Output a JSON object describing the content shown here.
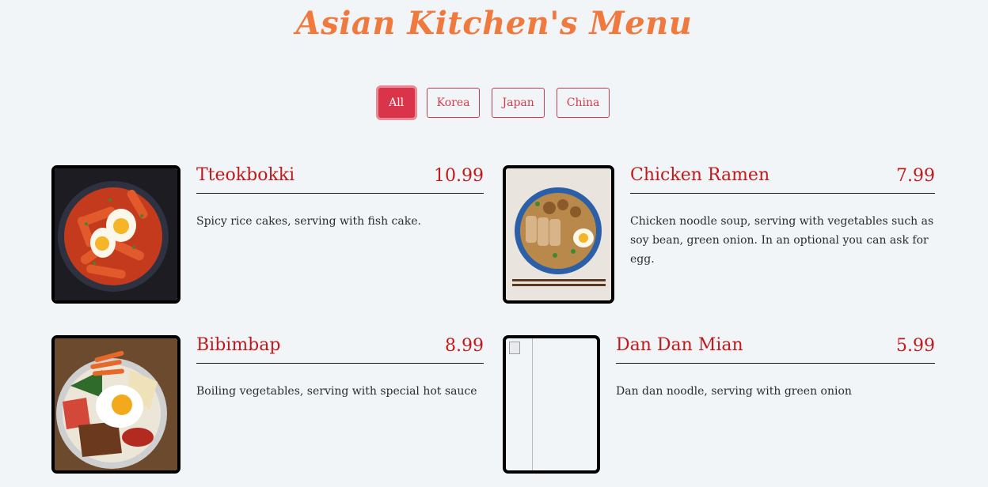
{
  "header": {
    "title": "Asian Kitchen's Menu"
  },
  "filters": [
    {
      "label": "All",
      "active": true
    },
    {
      "label": "Korea",
      "active": false
    },
    {
      "label": "Japan",
      "active": false
    },
    {
      "label": "China",
      "active": false
    }
  ],
  "items": [
    {
      "name": "Tteokbokki",
      "price": "10.99",
      "desc": "Spicy rice cakes, serving with fish cake."
    },
    {
      "name": "Chicken Ramen",
      "price": "7.99",
      "desc": "Chicken noodle soup, serving with vegetables such as soy bean, green onion. In an optional you can ask for egg."
    },
    {
      "name": "Bibimbap",
      "price": "8.99",
      "desc": "Boiling vegetables, serving with special hot sauce"
    },
    {
      "name": "Dan Dan Mian",
      "price": "5.99",
      "desc": "Dan dan noodle, serving with green onion"
    }
  ]
}
